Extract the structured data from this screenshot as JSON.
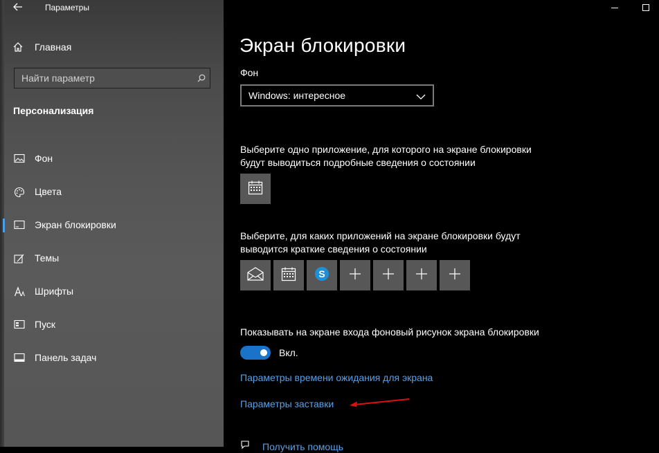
{
  "window": {
    "title": "Параметры",
    "back_icon": "arrow-left-icon",
    "minimize_icon": "minimize-icon",
    "maximize_icon": "maximize-icon"
  },
  "sidebar": {
    "home_label": "Главная",
    "home_icon": "home-icon",
    "search_placeholder": "Найти параметр",
    "search_icon": "search-icon",
    "section_title": "Персонализация",
    "items": [
      {
        "label": "Фон",
        "icon": "picture-icon",
        "active": false
      },
      {
        "label": "Цвета",
        "icon": "palette-icon",
        "active": false
      },
      {
        "label": "Экран блокировки",
        "icon": "lock-screen-icon",
        "active": true
      },
      {
        "label": "Темы",
        "icon": "themes-icon",
        "active": false
      },
      {
        "label": "Шрифты",
        "icon": "fonts-icon",
        "active": false
      },
      {
        "label": "Пуск",
        "icon": "start-icon",
        "active": false
      },
      {
        "label": "Панель задач",
        "icon": "taskbar-icon",
        "active": false
      }
    ]
  },
  "main": {
    "title": "Экран блокировки",
    "background_label": "Фон",
    "background_value": "Windows: интересное",
    "detailed_status_text": "Выберите одно приложение, для которого на экране блокировки будут выводиться подробные сведения о состоянии",
    "detailed_status_app_icon": "calendar-icon",
    "quick_status_text": "Выберите, для каких приложений на экране блокировки будут выводится краткие сведения о состоянии",
    "quick_status_apps": [
      "mail-icon",
      "calendar-icon",
      "skype-icon",
      "plus-icon",
      "plus-icon",
      "plus-icon",
      "plus-icon"
    ],
    "signin_bg_text": "Показывать на экране входа фоновый рисунок экрана блокировки",
    "toggle_on": true,
    "toggle_label": "Вкл.",
    "link_timeout": "Параметры времени ожидания для экрана",
    "link_screensaver": "Параметры заставки",
    "help_label": "Получить помощь",
    "help_icon": "help-chat-icon"
  },
  "colors": {
    "accent": "#1a72c9",
    "link": "#5aa0e6",
    "annotation_arrow": "#e01010",
    "tile": "#575757"
  }
}
